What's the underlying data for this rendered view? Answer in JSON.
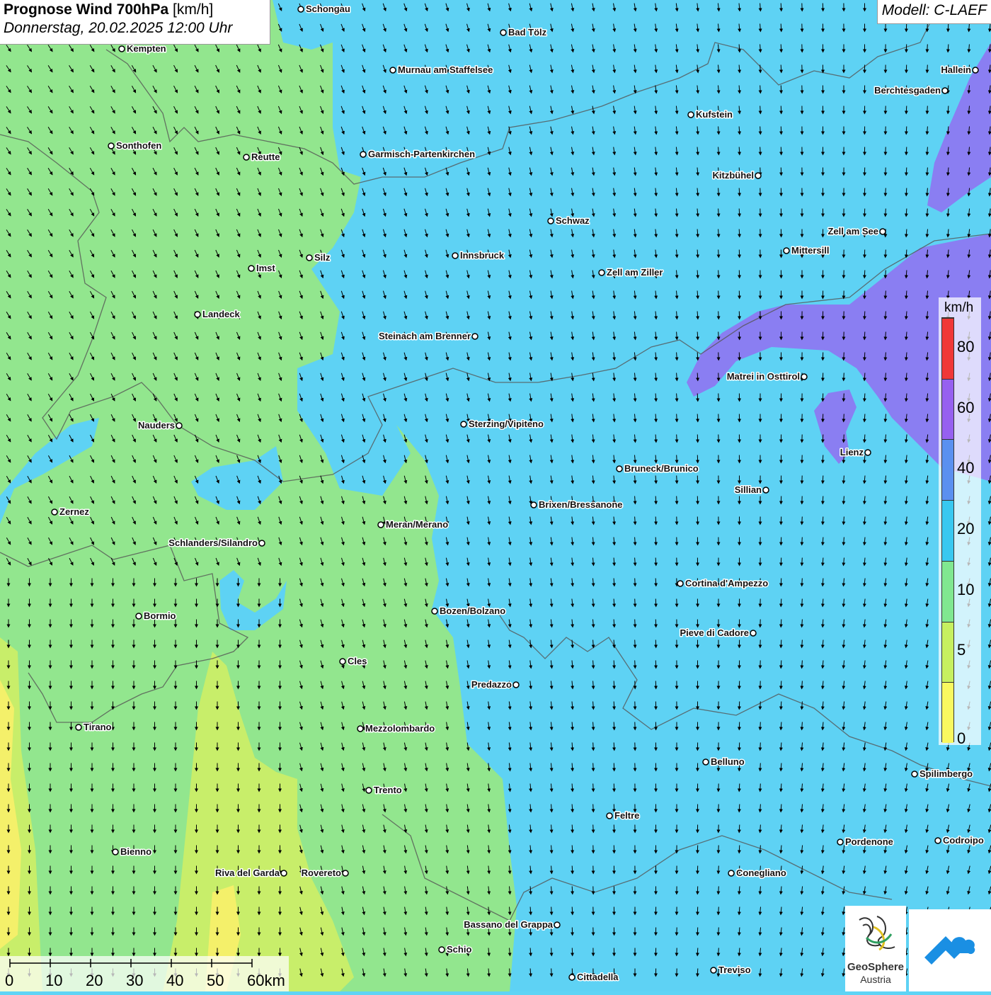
{
  "header": {
    "title_bold": "Prognose Wind 700hPa",
    "title_unit": "[km/h]",
    "datetime": "Donnerstag, 20.02.2025 12:00 Uhr",
    "model": "Modell: C-LAEF"
  },
  "legend": {
    "unit": "km/h",
    "ticks": [
      "0",
      "5",
      "10",
      "20",
      "40",
      "60",
      "80"
    ],
    "colors": [
      "#f8f860",
      "#c6f060",
      "#80e890",
      "#38c8f0",
      "#5a90f0",
      "#9660f0",
      "#f03838"
    ]
  },
  "scalebar": {
    "labels": [
      "0",
      "10",
      "20",
      "30",
      "40",
      "50",
      "60km"
    ]
  },
  "logos": {
    "geosphere_line1": "GeoSphere",
    "geosphere_line2": "Austria"
  },
  "map": {
    "colors": {
      "speed_0_5": "#f4f06a",
      "speed_5_10": "#c8ee6a",
      "speed_10_20": "#92e68e",
      "speed_20_40": "#5ed2f4",
      "speed_40_60": "#6aa2ee",
      "speed_60_80": "#8a7ef2",
      "border": "#555555",
      "arrow": "#000000"
    },
    "cities": [
      {
        "name": "Schongau",
        "pos": "right"
      },
      {
        "name": "Bad Tölz",
        "pos": "right"
      },
      {
        "name": "Kempten",
        "pos": "right"
      },
      {
        "name": "Murnau am Staffelsee",
        "pos": "right"
      },
      {
        "name": "Hallein",
        "pos": "left"
      },
      {
        "name": "Berchtesgaden",
        "pos": "left"
      },
      {
        "name": "Kufstein",
        "pos": "right"
      },
      {
        "name": "Sonthofen",
        "pos": "right"
      },
      {
        "name": "Reutte",
        "pos": "right"
      },
      {
        "name": "Garmisch-Partenkirchen",
        "pos": "right"
      },
      {
        "name": "Kitzbühel",
        "pos": "left"
      },
      {
        "name": "Schwaz",
        "pos": "right"
      },
      {
        "name": "Zell am See",
        "pos": "left"
      },
      {
        "name": "Mittersill",
        "pos": "right"
      },
      {
        "name": "Innsbruck",
        "pos": "right"
      },
      {
        "name": "Silz",
        "pos": "right"
      },
      {
        "name": "Imst",
        "pos": "right"
      },
      {
        "name": "Zell am Ziller",
        "pos": "right"
      },
      {
        "name": "Landeck",
        "pos": "right"
      },
      {
        "name": "Steinach am Brenner",
        "pos": "left"
      },
      {
        "name": "Matrei in Osttirol",
        "pos": "left"
      },
      {
        "name": "Nauders",
        "pos": "left"
      },
      {
        "name": "Sterzing/Vipiteno",
        "pos": "right"
      },
      {
        "name": "Lienz",
        "pos": "left"
      },
      {
        "name": "Bruneck/Brunico",
        "pos": "right"
      },
      {
        "name": "Sillian",
        "pos": "left"
      },
      {
        "name": "Zernez",
        "pos": "right"
      },
      {
        "name": "Brixen/Bressanone",
        "pos": "right"
      },
      {
        "name": "Meran/Merano",
        "pos": "right"
      },
      {
        "name": "Schlanders/Silandro",
        "pos": "left"
      },
      {
        "name": "Cortina d'Ampezzo",
        "pos": "right"
      },
      {
        "name": "Bozen/Bolzano",
        "pos": "right"
      },
      {
        "name": "Bormio",
        "pos": "right"
      },
      {
        "name": "Pieve di Cadore",
        "pos": "left"
      },
      {
        "name": "Cles",
        "pos": "right"
      },
      {
        "name": "Predazzo",
        "pos": "left"
      },
      {
        "name": "Tirano",
        "pos": "right"
      },
      {
        "name": "Mezzolombardo",
        "pos": "right"
      },
      {
        "name": "Belluno",
        "pos": "right"
      },
      {
        "name": "Spilimbergo",
        "pos": "right"
      },
      {
        "name": "Trento",
        "pos": "right"
      },
      {
        "name": "Feltre",
        "pos": "right"
      },
      {
        "name": "Pordenone",
        "pos": "right"
      },
      {
        "name": "Codroipo",
        "pos": "right"
      },
      {
        "name": "Bienno",
        "pos": "right"
      },
      {
        "name": "Riva del Garda",
        "pos": "left"
      },
      {
        "name": "Rovereto",
        "pos": "left"
      },
      {
        "name": "Conegliano",
        "pos": "right"
      },
      {
        "name": "Bassano del Grappa",
        "pos": "left"
      },
      {
        "name": "Schio",
        "pos": "right"
      },
      {
        "name": "Cittadella",
        "pos": "right"
      },
      {
        "name": "Treviso",
        "pos": "right"
      }
    ]
  }
}
